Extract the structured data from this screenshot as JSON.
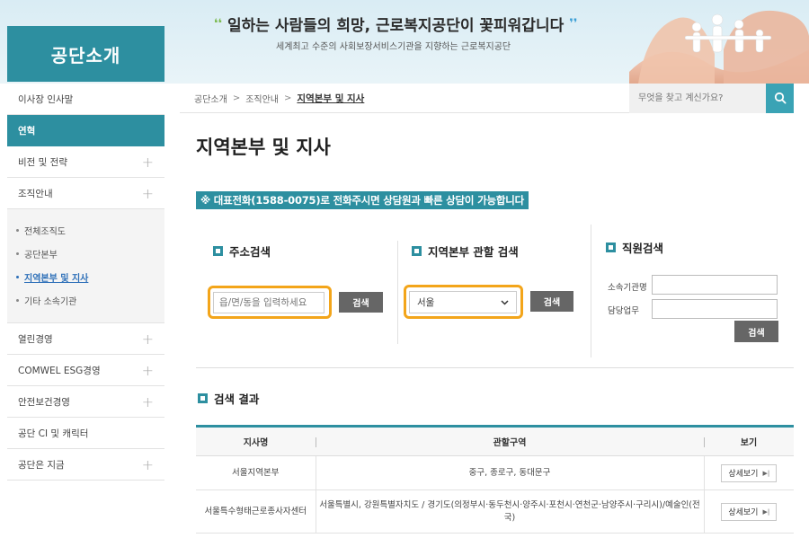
{
  "banner": {
    "tagline": "일하는 사람들의 희망, 근로복지공단이 꽃피워갑니다",
    "subtitle": "세계최고 수준의 사회보장서비스기관을 지향하는 근로복지공단"
  },
  "section_title": "공단소개",
  "sidebar": {
    "items": [
      {
        "label": "이사장 인사말",
        "has_plus": false
      },
      {
        "label": "연혁",
        "active": true
      },
      {
        "label": "비전 및 전략",
        "has_plus": true
      },
      {
        "label": "조직안내",
        "has_plus": true
      }
    ],
    "sub_items": [
      {
        "label": "전체조직도"
      },
      {
        "label": "공단본부"
      },
      {
        "label": "지역본부 및 지사",
        "current": true
      },
      {
        "label": "기타 소속기관"
      }
    ],
    "more_items": [
      {
        "label": "열린경영"
      },
      {
        "label": "COMWEL ESG경영"
      },
      {
        "label": "안전보건경영"
      },
      {
        "label": "공단 CI 및 캐릭터"
      },
      {
        "label": "공단은 지금"
      }
    ]
  },
  "breadcrumb": [
    "공단소개",
    "조직안내",
    "지역본부 및 지사"
  ],
  "top_search": {
    "placeholder": "무엇을 찾고 계신가요?"
  },
  "page_title": "지역본부 및 지사",
  "notice": "※ 대표전화(1588-0075)로 전화주시면 상담원과 빠른 상담이 가능합니다",
  "address_search": {
    "title": "주소검색",
    "placeholder": "읍/면/동을 입력하세요",
    "button": "검색"
  },
  "region_search": {
    "title": "지역본부 관할 검색",
    "selected": "서울",
    "button": "검색"
  },
  "employee_search": {
    "title": "직원검색",
    "org_label": "소속기관명",
    "duty_label": "담당업무",
    "button": "검색"
  },
  "results": {
    "title": "검색 결과",
    "columns": [
      "지사명",
      "관할구역",
      "보기"
    ],
    "rows": [
      {
        "name": "서울지역본부",
        "area": "중구, 종로구, 동대문구",
        "action": "상세보기"
      },
      {
        "name": "서울특수형태근로종사자센터",
        "area": "서울특별시, 강원특별자치도 / 경기도(의정부시·동두천시·양주시·포천시·연천군·남양주시·구리시)/예술인(전국)",
        "action": "상세보기"
      }
    ]
  },
  "colors": {
    "accent": "#2d8fa0",
    "highlight": "#f3a51a",
    "search_button": "#3aa3b5"
  }
}
